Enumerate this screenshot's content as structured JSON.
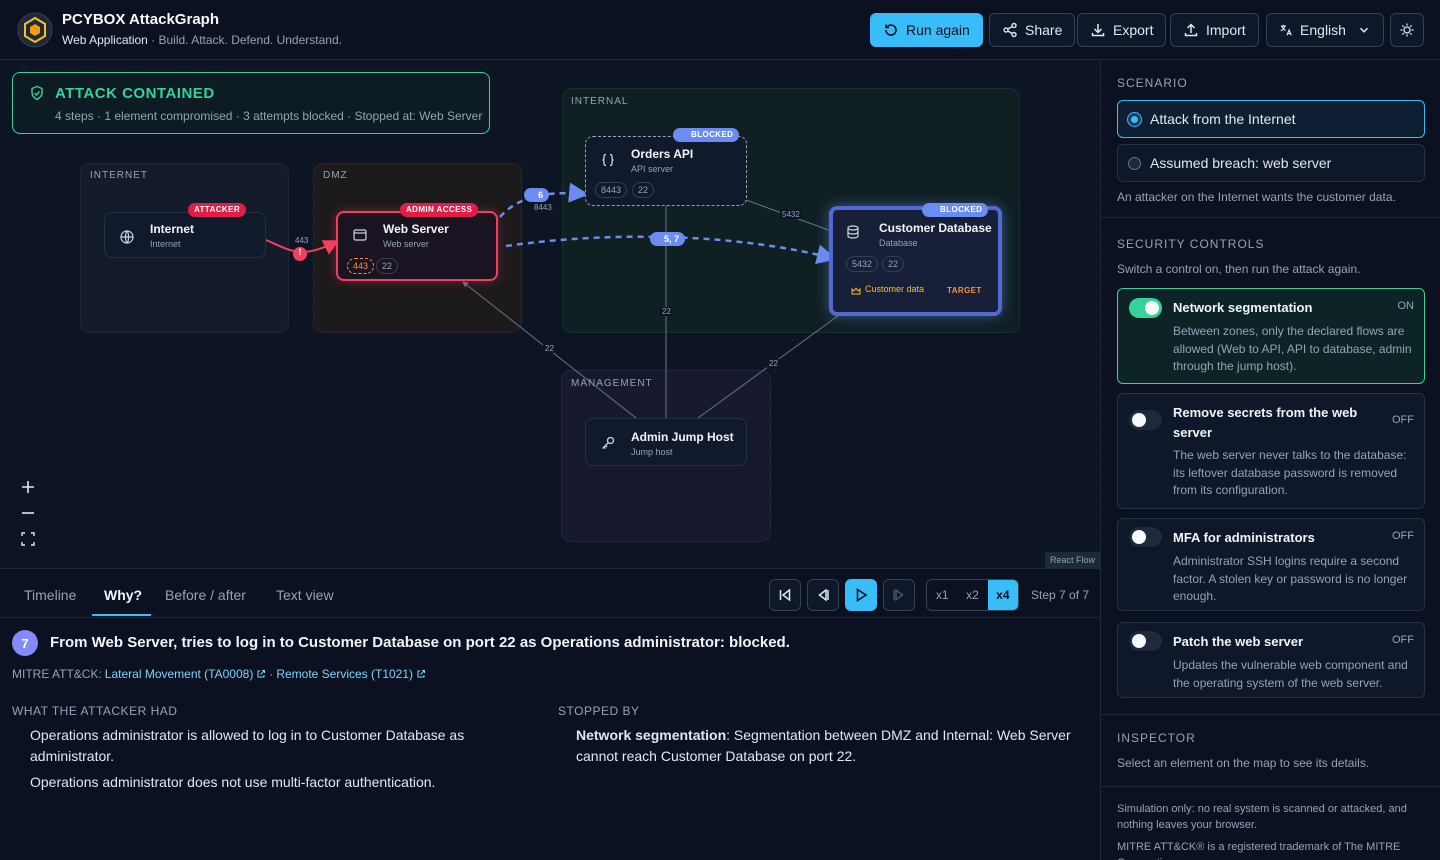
{
  "header": {
    "title": "PCYBOX AttackGraph",
    "subtitle_strong": "Web Application",
    "subtitle_rest": " · Build. Attack. Defend. Understand.",
    "buttons": {
      "run_again": "Run again",
      "share": "Share",
      "export": "Export",
      "import": "Import",
      "language": "English"
    }
  },
  "status": {
    "title": "ATTACK CONTAINED",
    "detail": "4 steps · 1 element compromised · 3 attempts blocked · Stopped at: Web Server"
  },
  "zones": {
    "internet": "INTERNET",
    "dmz": "DMZ",
    "internal": "INTERNAL",
    "management": "MANAGEMENT"
  },
  "nodes": {
    "internet": {
      "title": "Internet",
      "type": "Internet",
      "badge": "ATTACKER"
    },
    "web_server": {
      "title": "Web Server",
      "type": "Web server",
      "badge": "ADMIN ACCESS",
      "ports": [
        "443",
        "22"
      ]
    },
    "orders_api": {
      "title": "Orders API",
      "type": "API server",
      "badge": "BLOCKED",
      "ports": [
        "8443",
        "22"
      ]
    },
    "customer_db": {
      "title": "Customer Database",
      "type": "Database",
      "badge": "BLOCKED",
      "ports": [
        "5432",
        "22"
      ],
      "asset": "Customer data",
      "target": "TARGET"
    },
    "jump_host": {
      "title": "Admin Jump Host",
      "type": "Jump host"
    }
  },
  "edges": {
    "inet_web": "443",
    "blocked_marker": "!",
    "web_api": "8443",
    "api_db": "5432",
    "jump_web": "22",
    "jump_api": "22",
    "jump_db": "22",
    "step_marker_a": "6",
    "step_marker_b": "5, 7"
  },
  "canvas": {
    "react_flow": "React Flow"
  },
  "tabs": [
    "Timeline",
    "Why?",
    "Before / after",
    "Text view"
  ],
  "playback": {
    "speeds": [
      "x1",
      "x2",
      "x4"
    ],
    "active_speed": "x4",
    "step_label": "Step 7 of 7"
  },
  "step": {
    "number": "7",
    "title": "From Web Server, tries to log in to Customer Database on port 22 as Operations administrator: blocked.",
    "mitre_prefix": "MITRE ATT&CK:",
    "tactic": "Lateral Movement (TA0008)",
    "separator": "·",
    "technique": "Remote Services (T1021)"
  },
  "why": {
    "had_heading": "WHAT THE ATTACKER HAD",
    "had": [
      "Operations administrator is allowed to log in to Customer Database as administrator.",
      "Operations administrator does not use multi-factor authentication."
    ],
    "stopped_heading": "STOPPED BY",
    "stopped_control": "Network segmentation",
    "stopped_text": ": Segmentation between DMZ and Internal: Web Server cannot reach Customer Database on port 22."
  },
  "sidebar": {
    "scenario_heading": "SCENARIO",
    "scenarios": [
      "Attack from the Internet",
      "Assumed breach: web server"
    ],
    "scenario_desc": "An attacker on the Internet wants the customer data.",
    "controls_heading": "SECURITY CONTROLS",
    "controls_hint": "Switch a control on, then run the attack again.",
    "controls": [
      {
        "title": "Network segmentation",
        "state": "ON",
        "desc": "Between zones, only the declared flows are allowed (Web to API, API to database, admin through the jump host)."
      },
      {
        "title": "Remove secrets from the web server",
        "state": "OFF",
        "desc": "The web server never talks to the database: its leftover database password is removed from its configuration."
      },
      {
        "title": "MFA for administrators",
        "state": "OFF",
        "desc": "Administrator SSH logins require a second factor. A stolen key or password is no longer enough."
      },
      {
        "title": "Patch the web server",
        "state": "OFF",
        "desc": "Updates the vulnerable web component and the operating system of the web server."
      }
    ],
    "inspector_heading": "INSPECTOR",
    "inspector_hint": "Select an element on the map to see its details.",
    "footer_1": "Simulation only: no real system is scanned or attacked, and nothing leaves your browser.",
    "footer_2": "MITRE ATT&CK® is a registered trademark of The MITRE Corporation."
  },
  "colors": {
    "accent": "#38bdf8",
    "success": "#34d399",
    "danger": "#e11d48",
    "blocked": "#6b8cf0",
    "background": "#0b1120"
  }
}
